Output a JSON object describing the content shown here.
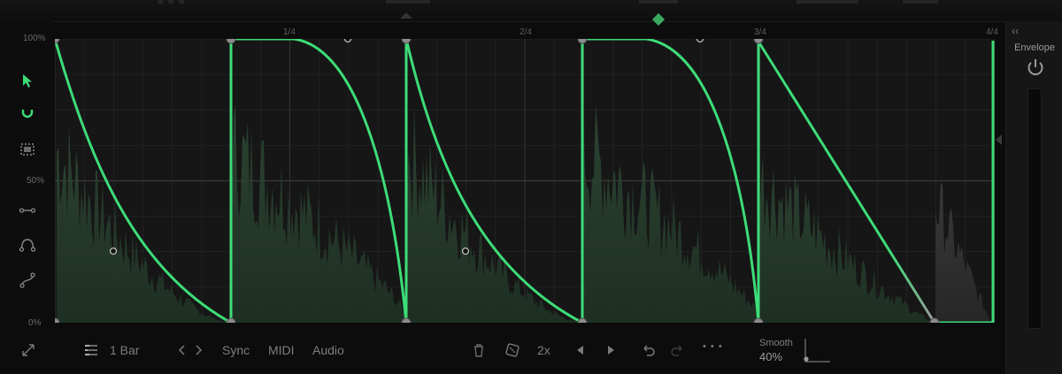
{
  "colors": {
    "curve": "#3ddc78",
    "node": "#8c8c8c",
    "grid": "#2a2a2a",
    "background": "#161616"
  },
  "toolbar_left": {
    "tools": [
      "pointer-icon",
      "magnet-icon",
      "select-box-icon",
      "line-tool-icon",
      "arc-tool-icon",
      "curve-tool-icon"
    ]
  },
  "grid": {
    "y_labels": [
      "100%",
      "50%",
      "0%"
    ],
    "x_labels": [
      "1/4",
      "2/4",
      "3/4",
      "4/4"
    ]
  },
  "right_panel": {
    "title": "Envelope",
    "collapse_label": "‹‹"
  },
  "bottom": {
    "bar_length": "1 Bar",
    "sync_label": "Sync",
    "midi_label": "MIDI",
    "audio_label": "Audio",
    "multiplier_label": "2x",
    "more_label": "• • •",
    "smooth_label": "Smooth",
    "smooth_value": "40%",
    "smooth_amount": 0.4
  }
}
